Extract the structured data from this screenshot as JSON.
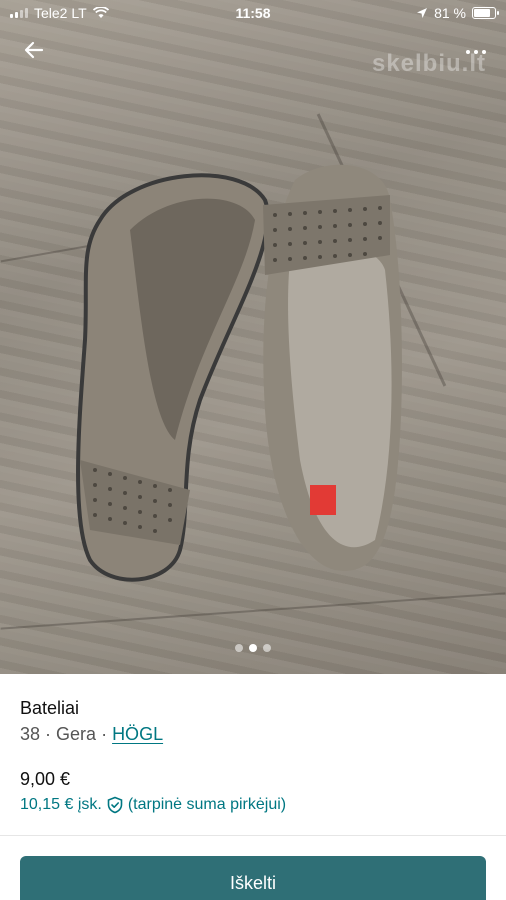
{
  "status_bar": {
    "carrier": "Tele2 LT",
    "time": "11:58",
    "battery_percent": "81 %",
    "battery_level": 0.81
  },
  "photo": {
    "watermark": "skelbiu.lt",
    "carousel_count": 3,
    "carousel_active": 1
  },
  "item": {
    "title": "Bateliai",
    "size": "38",
    "separator": "·",
    "condition": "Gera",
    "brand": "HÖGL",
    "price": "9,00 €",
    "price_incl": "10,15 € įsk.",
    "price_note": "(tarpinė suma pirkėjui)"
  },
  "actions": {
    "bump_label": "Iškelti"
  },
  "colors": {
    "accent": "#007782",
    "button": "#2f6f76"
  }
}
